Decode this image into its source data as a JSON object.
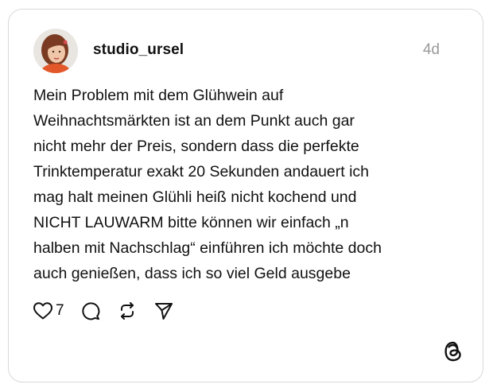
{
  "post": {
    "username": "studio_ursel",
    "timestamp": "4d",
    "text": "Mein Problem mit dem Glühwein auf\nWeihnachtsmärkten ist an dem Punkt auch gar\nnicht mehr der Preis, sondern dass die perfekte\nTrinktemperatur exakt 20 Sekunden andauert ich\nmag halt meinen Glühli heiß nicht kochend und\nNICHT LAUWARM bitte können wir einfach „n\nhalben mit Nachschlag“ einführen ich möchte doch\nauch genießen, dass ich so viel Geld ausgebe"
  },
  "actions": {
    "like_count": "7",
    "icons": [
      "heart-icon",
      "comment-icon",
      "repost-icon",
      "share-icon"
    ]
  },
  "branding": {
    "logo": "threads-logo-icon"
  },
  "colors": {
    "text": "#111111",
    "muted": "#9a9a9a",
    "border": "#d9d9d9",
    "background": "#ffffff"
  }
}
